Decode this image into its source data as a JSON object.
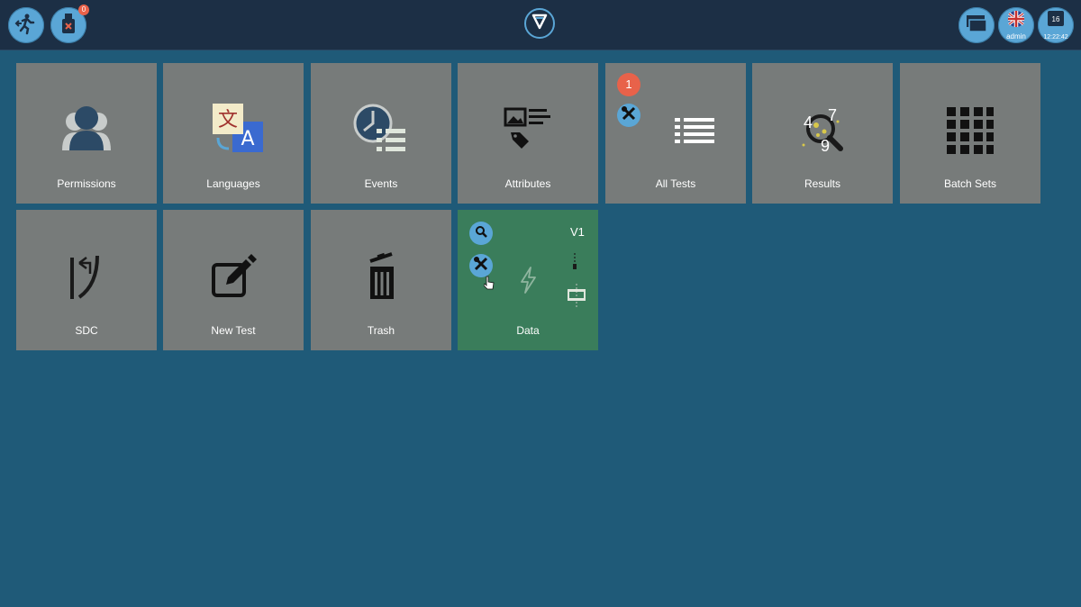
{
  "topbar": {
    "exit_icon": "exit-run-icon",
    "usb_icon": "usb-drive-icon",
    "usb_badge": "0",
    "logo_icon": "v-logo-icon",
    "windows_icon": "windows-stack-icon",
    "language_user_label": "admin",
    "calendar_day": "16",
    "clock_time": "12:22:42"
  },
  "tiles": [
    {
      "label": "Permissions",
      "icon": "users-icon"
    },
    {
      "label": "Languages",
      "icon": "translate-icon"
    },
    {
      "label": "Events",
      "icon": "clock-list-icon"
    },
    {
      "label": "Attributes",
      "icon": "image-tag-icon"
    },
    {
      "label": "All Tests",
      "icon": "list-icon",
      "notification": "1"
    },
    {
      "label": "Results",
      "icon": "magnify-numbers-icon",
      "numbers": [
        "4",
        "7",
        "9"
      ]
    },
    {
      "label": "Batch Sets",
      "icon": "grid-icon"
    },
    {
      "label": "SDC",
      "icon": "sdc-icon"
    },
    {
      "label": "New Test",
      "icon": "edit-icon"
    },
    {
      "label": "Trash",
      "icon": "trash-icon"
    },
    {
      "label": "Data",
      "icon": "bolt-icon",
      "version": "V1"
    }
  ],
  "colors": {
    "background": "#1f5a78",
    "topbar": "#1c2f45",
    "tile": "#777b7a",
    "tile_active": "#3a7d5b",
    "accent": "#5aa6d6",
    "notification": "#e8624a"
  }
}
